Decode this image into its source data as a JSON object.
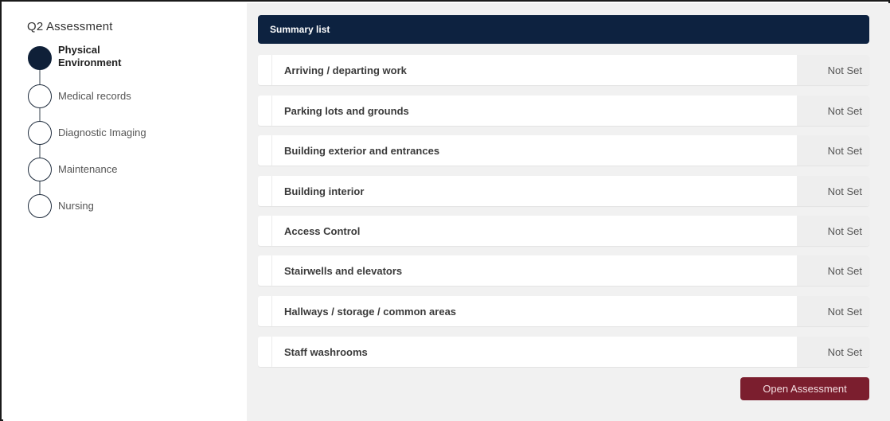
{
  "sidebar": {
    "title": "Q2 Assessment",
    "steps": [
      {
        "label": "Physical Environment",
        "active": true
      },
      {
        "label": "Medical records",
        "active": false
      },
      {
        "label": "Diagnostic Imaging",
        "active": false
      },
      {
        "label": "Maintenance",
        "active": false
      },
      {
        "label": "Nursing",
        "active": false
      }
    ]
  },
  "main": {
    "header": "Summary list",
    "rows": [
      {
        "name": "Arriving / departing work",
        "status": "Not Set"
      },
      {
        "name": "Parking lots and grounds",
        "status": "Not Set"
      },
      {
        "name": "Building exterior and entrances",
        "status": "Not Set"
      },
      {
        "name": "Building interior",
        "status": "Not Set"
      },
      {
        "name": "Access Control",
        "status": "Not Set"
      },
      {
        "name": "Stairwells and elevators",
        "status": "Not Set"
      },
      {
        "name": "Hallways / storage / common areas",
        "status": "Not Set"
      },
      {
        "name": "Staff washrooms",
        "status": "Not Set"
      }
    ],
    "open_button": "Open Assessment"
  },
  "colors": {
    "navy": "#0d2240",
    "button": "#7b1e2e",
    "status_bg": "#eeeeee",
    "panel_bg": "#f1f1f1"
  }
}
